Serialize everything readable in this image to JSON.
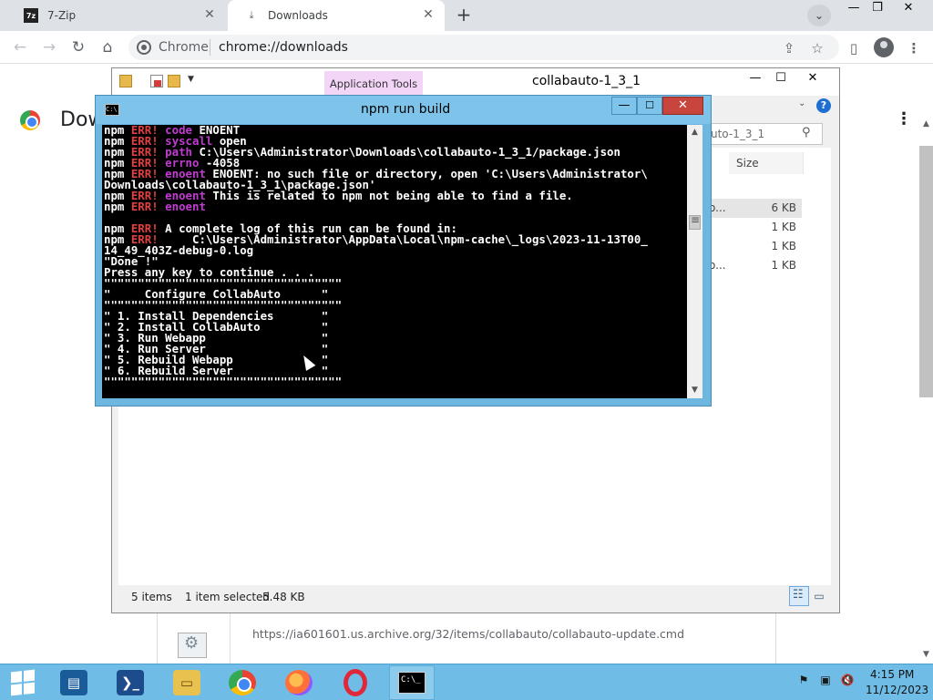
{
  "chrome": {
    "tabs": [
      {
        "label": "7-Zip",
        "icon": "7zip-icon"
      },
      {
        "label": "Downloads",
        "icon": "download-icon"
      }
    ],
    "omnibox": {
      "site_label": "Chrome",
      "url": "chrome://downloads"
    },
    "page": {
      "title": "Dow",
      "download_item": {
        "url": "https://ia601601.us.archive.org/32/items/collabauto/collabauto-update.cmd"
      }
    }
  },
  "explorer": {
    "ribbon_tab": "Application Tools",
    "title": "collabauto-1_3_1",
    "search_text": "uto-1_3_1",
    "column_size": "Size",
    "rows": [
      {
        "name_fragment": "o...",
        "size": "6 KB"
      },
      {
        "name_fragment": "",
        "size": "1 KB"
      },
      {
        "name_fragment": "",
        "size": "1 KB"
      },
      {
        "name_fragment": "o...",
        "size": "1 KB"
      }
    ],
    "status": {
      "items": "5 items",
      "selected": "1 item selected",
      "size": "5.48 KB"
    }
  },
  "cmd": {
    "title": "npm run build",
    "icon_text": "C:\\",
    "lines": [
      [
        [
          "npm ",
          "n"
        ],
        [
          "ERR!",
          "e"
        ],
        [
          " code",
          "k"
        ],
        [
          " ENOENT",
          "n"
        ]
      ],
      [
        [
          "npm ",
          "n"
        ],
        [
          "ERR!",
          "e"
        ],
        [
          " syscall",
          "k"
        ],
        [
          " open",
          "n"
        ]
      ],
      [
        [
          "npm ",
          "n"
        ],
        [
          "ERR!",
          "e"
        ],
        [
          " path",
          "k"
        ],
        [
          " C:\\Users\\Administrator\\Downloads\\collabauto-1_3_1/package.json",
          "n"
        ]
      ],
      [
        [
          "npm ",
          "n"
        ],
        [
          "ERR!",
          "e"
        ],
        [
          " errno",
          "k"
        ],
        [
          " -4058",
          "n"
        ]
      ],
      [
        [
          "npm ",
          "n"
        ],
        [
          "ERR!",
          "e"
        ],
        [
          " enoent",
          "k"
        ],
        [
          " ENOENT: no such file or directory, open 'C:\\Users\\Administrator\\",
          "n"
        ]
      ],
      [
        [
          "Downloads\\collabauto-1_3_1\\package.json'",
          "n"
        ]
      ],
      [
        [
          "npm ",
          "n"
        ],
        [
          "ERR!",
          "e"
        ],
        [
          " enoent",
          "k"
        ],
        [
          " This is related to npm not being able to find a file.",
          "n"
        ]
      ],
      [
        [
          "npm ",
          "n"
        ],
        [
          "ERR!",
          "e"
        ],
        [
          " enoent",
          "k"
        ]
      ],
      [
        [
          "",
          "n"
        ]
      ],
      [
        [
          "npm ",
          "n"
        ],
        [
          "ERR!",
          "e"
        ],
        [
          " A complete log of this run can be found in:",
          "n"
        ]
      ],
      [
        [
          "npm ",
          "n"
        ],
        [
          "ERR!",
          "e"
        ],
        [
          "     C:\\Users\\Administrator\\AppData\\Local\\npm-cache\\_logs\\2023-11-13T00_",
          "n"
        ]
      ],
      [
        [
          "14_49_403Z-debug-0.log",
          "n"
        ]
      ],
      [
        [
          "\"Done !\"",
          "n"
        ]
      ],
      [
        [
          "Press any key to continue . . .",
          "n"
        ]
      ],
      [
        [
          "\"\"\"\"\"\"\"\"\"\"\"\"\"\"\"\"\"\"\"\"\"\"\"\"\"\"\"\"\"\"\"\"\"\"\"",
          "n"
        ]
      ],
      [
        [
          "\"     Configure CollabAuto      \"",
          "n"
        ]
      ],
      [
        [
          "\"\"\"\"\"\"\"\"\"\"\"\"\"\"\"\"\"\"\"\"\"\"\"\"\"\"\"\"\"\"\"\"\"\"\"",
          "n"
        ]
      ],
      [
        [
          "\" 1. Install Dependencies       \"",
          "n"
        ]
      ],
      [
        [
          "\" 2. Install CollabAuto         \"",
          "n"
        ]
      ],
      [
        [
          "\" 3. Run Webapp                 \"",
          "n"
        ]
      ],
      [
        [
          "\" 4. Run Server                 \"",
          "n"
        ]
      ],
      [
        [
          "\" 5. Rebuild Webapp             \"",
          "n"
        ]
      ],
      [
        [
          "\" 6. Rebuild Server             \"",
          "n"
        ]
      ],
      [
        [
          "\"\"\"\"\"\"\"\"\"\"\"\"\"\"\"\"\"\"\"\"\"\"\"\"\"\"\"\"\"\"\"\"\"\"\"",
          "n"
        ]
      ]
    ]
  },
  "taskbar": {
    "apps": [
      "start",
      "server-manager",
      "powershell",
      "file-explorer",
      "chrome",
      "firefox",
      "opera",
      "command-prompt"
    ],
    "cmd_icon_text": "C:\\_",
    "clock": {
      "time": "4:15 PM",
      "date": "11/12/2023"
    }
  },
  "colors": {
    "cmd_err": "#e04040",
    "cmd_keyword": "#c03cd0",
    "taskbar": "#6fbde6",
    "apptools_tab": "#f2d5f7"
  }
}
